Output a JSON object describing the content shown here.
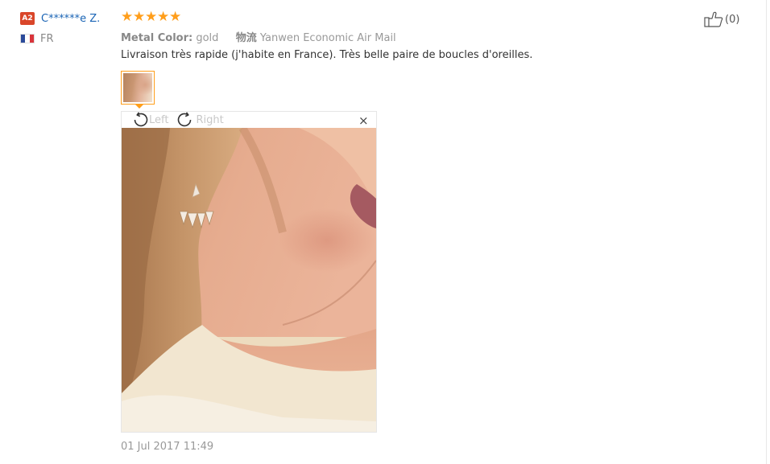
{
  "user": {
    "level_badge": "A2",
    "name": "C******e Z.",
    "country_code": "FR",
    "flag_colors": [
      "#2b4a9a",
      "#ffffff",
      "#d9343b"
    ]
  },
  "review": {
    "rating": 5,
    "max_rating": 5,
    "stars": [
      "★",
      "★",
      "★",
      "★",
      "★"
    ],
    "star_color": "#ff9e1b",
    "attributes": [
      {
        "label": "Metal Color:",
        "value": "gold"
      },
      {
        "label": "物流",
        "value": "Yanwen Economic Air Mail"
      }
    ],
    "text": "Livraison très rapide (j'habite en France). Très belle paire de boucles d'oreilles.",
    "date": "01 Jul 2017 11:49"
  },
  "viewer": {
    "rotate_left_label": "Left",
    "rotate_right_label": "Right",
    "close_glyph": "×",
    "thumbnail_border_color": "#ff9e1b"
  },
  "helpful": {
    "count": "(0)"
  },
  "colors": {
    "username": "#1a64b5",
    "level_badge": "#d9462a",
    "muted_text": "#999999",
    "accent": "#ff9e1b"
  }
}
